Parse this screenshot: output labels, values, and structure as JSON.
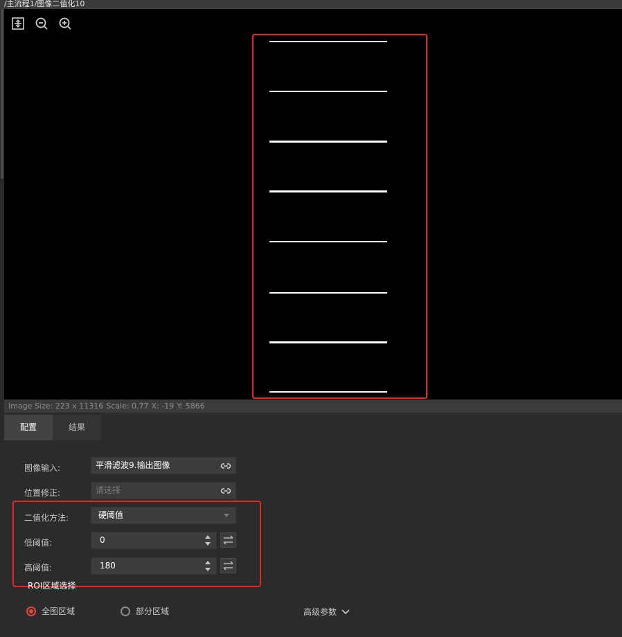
{
  "title": "/主流程1/图像二值化10",
  "viewer": {
    "tools": [
      {
        "icon": "fit-window-icon"
      },
      {
        "icon": "zoom-out-icon"
      },
      {
        "icon": "zoom-in-icon"
      }
    ],
    "roi_color": "#e32a22",
    "status": {
      "image_size": "Image Size: 223 x 11316",
      "scale": "Scale: 0.77",
      "x": "X: -19",
      "y": "Y: 5866"
    }
  },
  "tabs": [
    {
      "label": "配置",
      "active": true
    },
    {
      "label": "结果",
      "active": false
    }
  ],
  "form": {
    "image_input": {
      "label": "图像输入:",
      "value": "平滑滤波9.输出图像",
      "icon": "link-icon"
    },
    "position_fix": {
      "label": "位置修正:",
      "placeholder": "请选择",
      "icon": "link-icon"
    },
    "method": {
      "label": "二值化方法:",
      "value": "硬阈值",
      "icon": "chevron-down-icon"
    },
    "low_threshold": {
      "label": "低阈值:",
      "value": "0"
    },
    "high_threshold": {
      "label": "高阈值:",
      "value": "180"
    }
  },
  "roi": {
    "section_title": "ROI区域选择",
    "options": [
      {
        "label": "全图区域",
        "selected": true
      },
      {
        "label": "部分区域",
        "selected": false
      }
    ]
  },
  "advanced": {
    "label": "高级参数",
    "icon": "chevron-down-icon"
  },
  "accent_color": "#e8463f"
}
